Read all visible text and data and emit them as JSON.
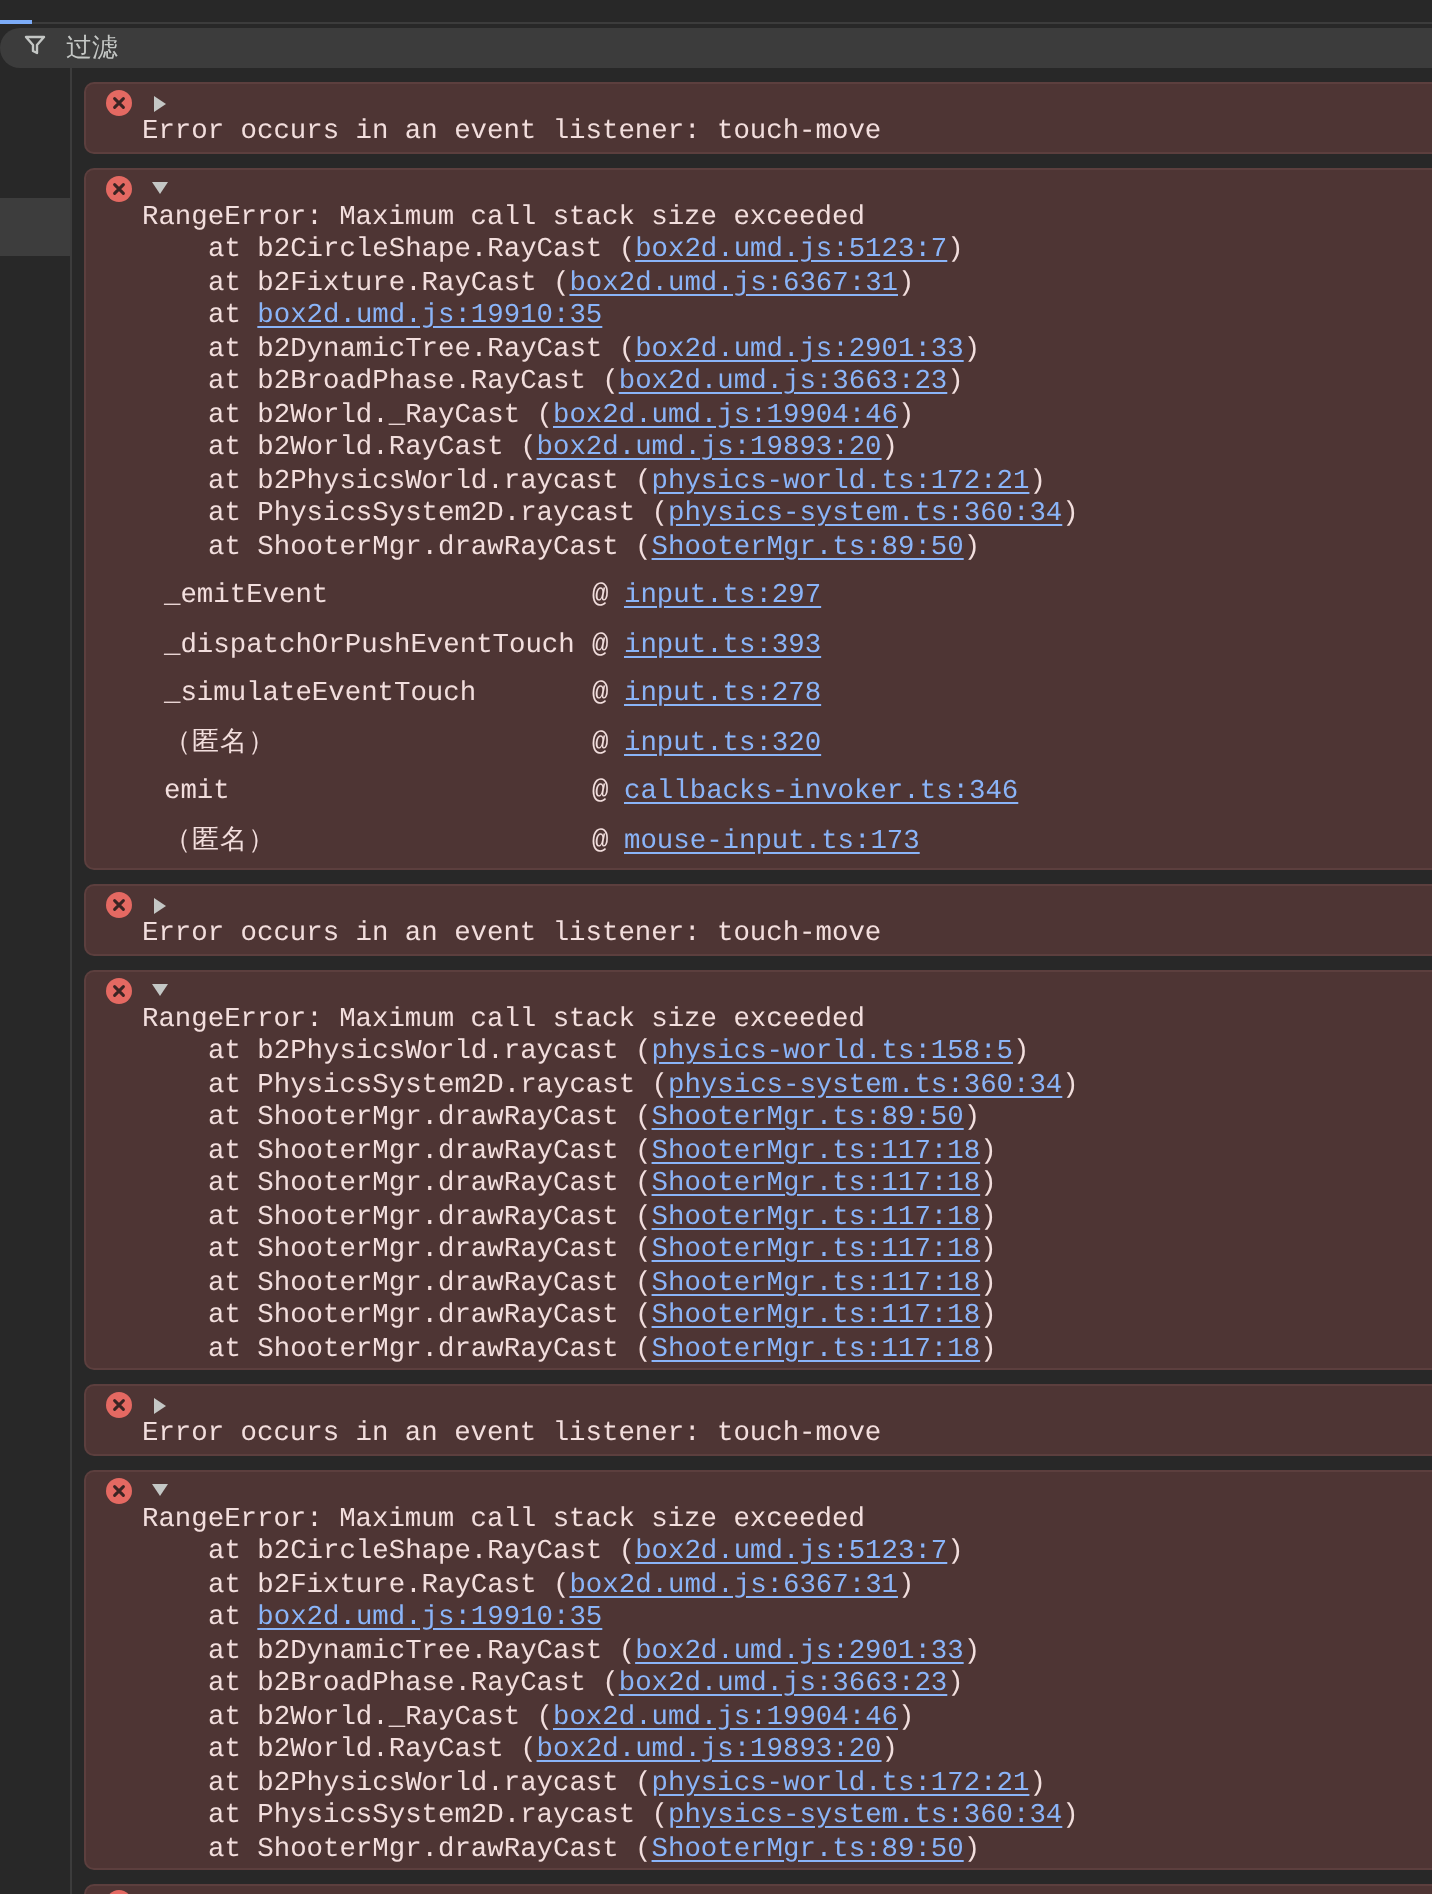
{
  "filter": {
    "placeholder": "过滤"
  },
  "messages": [
    {
      "kind": "error",
      "expanded": false,
      "text": "Error occurs in an event listener: touch-move"
    },
    {
      "kind": "error",
      "expanded": true,
      "text": "RangeError: Maximum call stack size exceeded",
      "stack": [
        {
          "prefix": "at b2CircleShape.RayCast (",
          "link": "box2d.umd.js:5123:7",
          "suffix": ")"
        },
        {
          "prefix": "at b2Fixture.RayCast (",
          "link": "box2d.umd.js:6367:31",
          "suffix": ")"
        },
        {
          "prefix": "at ",
          "link": "box2d.umd.js:19910:35"
        },
        {
          "prefix": "at b2DynamicTree.RayCast (",
          "link": "box2d.umd.js:2901:33",
          "suffix": ")"
        },
        {
          "prefix": "at b2BroadPhase.RayCast (",
          "link": "box2d.umd.js:3663:23",
          "suffix": ")"
        },
        {
          "prefix": "at b2World._RayCast (",
          "link": "box2d.umd.js:19904:46",
          "suffix": ")"
        },
        {
          "prefix": "at b2World.RayCast (",
          "link": "box2d.umd.js:19893:20",
          "suffix": ")"
        },
        {
          "prefix": "at b2PhysicsWorld.raycast (",
          "link": "physics-world.ts:172:21",
          "suffix": ")"
        },
        {
          "prefix": "at PhysicsSystem2D.raycast (",
          "link": "physics-system.ts:360:34",
          "suffix": ")"
        },
        {
          "prefix": "at ShooterMgr.drawRayCast (",
          "link": "ShooterMgr.ts:89:50",
          "suffix": ")"
        }
      ],
      "frames": [
        {
          "fn": "_emitEvent",
          "at": "@",
          "link": "input.ts:297"
        },
        {
          "fn": "_dispatchOrPushEventTouch",
          "at": "@",
          "link": "input.ts:393"
        },
        {
          "fn": "_simulateEventTouch",
          "at": "@",
          "link": "input.ts:278"
        },
        {
          "fn": "（匿名）",
          "at": "@",
          "link": "input.ts:320"
        },
        {
          "fn": "emit",
          "at": "@",
          "link": "callbacks-invoker.ts:346"
        },
        {
          "fn": "（匿名）",
          "at": "@",
          "link": "mouse-input.ts:173"
        }
      ]
    },
    {
      "kind": "error",
      "expanded": false,
      "text": "Error occurs in an event listener: touch-move"
    },
    {
      "kind": "error",
      "expanded": true,
      "text": "RangeError: Maximum call stack size exceeded",
      "stack": [
        {
          "prefix": "at b2PhysicsWorld.raycast (",
          "link": "physics-world.ts:158:5",
          "suffix": ")"
        },
        {
          "prefix": "at PhysicsSystem2D.raycast (",
          "link": "physics-system.ts:360:34",
          "suffix": ")"
        },
        {
          "prefix": "at ShooterMgr.drawRayCast (",
          "link": "ShooterMgr.ts:89:50",
          "suffix": ")"
        },
        {
          "prefix": "at ShooterMgr.drawRayCast (",
          "link": "ShooterMgr.ts:117:18",
          "suffix": ")"
        },
        {
          "prefix": "at ShooterMgr.drawRayCast (",
          "link": "ShooterMgr.ts:117:18",
          "suffix": ")"
        },
        {
          "prefix": "at ShooterMgr.drawRayCast (",
          "link": "ShooterMgr.ts:117:18",
          "suffix": ")"
        },
        {
          "prefix": "at ShooterMgr.drawRayCast (",
          "link": "ShooterMgr.ts:117:18",
          "suffix": ")"
        },
        {
          "prefix": "at ShooterMgr.drawRayCast (",
          "link": "ShooterMgr.ts:117:18",
          "suffix": ")"
        },
        {
          "prefix": "at ShooterMgr.drawRayCast (",
          "link": "ShooterMgr.ts:117:18",
          "suffix": ")"
        },
        {
          "prefix": "at ShooterMgr.drawRayCast (",
          "link": "ShooterMgr.ts:117:18",
          "suffix": ")"
        }
      ]
    },
    {
      "kind": "error",
      "expanded": false,
      "text": "Error occurs in an event listener: touch-move"
    },
    {
      "kind": "error",
      "expanded": true,
      "text": "RangeError: Maximum call stack size exceeded",
      "stack": [
        {
          "prefix": "at b2CircleShape.RayCast (",
          "link": "box2d.umd.js:5123:7",
          "suffix": ")"
        },
        {
          "prefix": "at b2Fixture.RayCast (",
          "link": "box2d.umd.js:6367:31",
          "suffix": ")"
        },
        {
          "prefix": "at ",
          "link": "box2d.umd.js:19910:35"
        },
        {
          "prefix": "at b2DynamicTree.RayCast (",
          "link": "box2d.umd.js:2901:33",
          "suffix": ")"
        },
        {
          "prefix": "at b2BroadPhase.RayCast (",
          "link": "box2d.umd.js:3663:23",
          "suffix": ")"
        },
        {
          "prefix": "at b2World._RayCast (",
          "link": "box2d.umd.js:19904:46",
          "suffix": ")"
        },
        {
          "prefix": "at b2World.RayCast (",
          "link": "box2d.umd.js:19893:20",
          "suffix": ")"
        },
        {
          "prefix": "at b2PhysicsWorld.raycast (",
          "link": "physics-world.ts:172:21",
          "suffix": ")"
        },
        {
          "prefix": "at PhysicsSystem2D.raycast (",
          "link": "physics-system.ts:360:34",
          "suffix": ")"
        },
        {
          "prefix": "at ShooterMgr.drawRayCast (",
          "link": "ShooterMgr.ts:89:50",
          "suffix": ")"
        }
      ]
    },
    {
      "kind": "cut_off"
    }
  ]
}
